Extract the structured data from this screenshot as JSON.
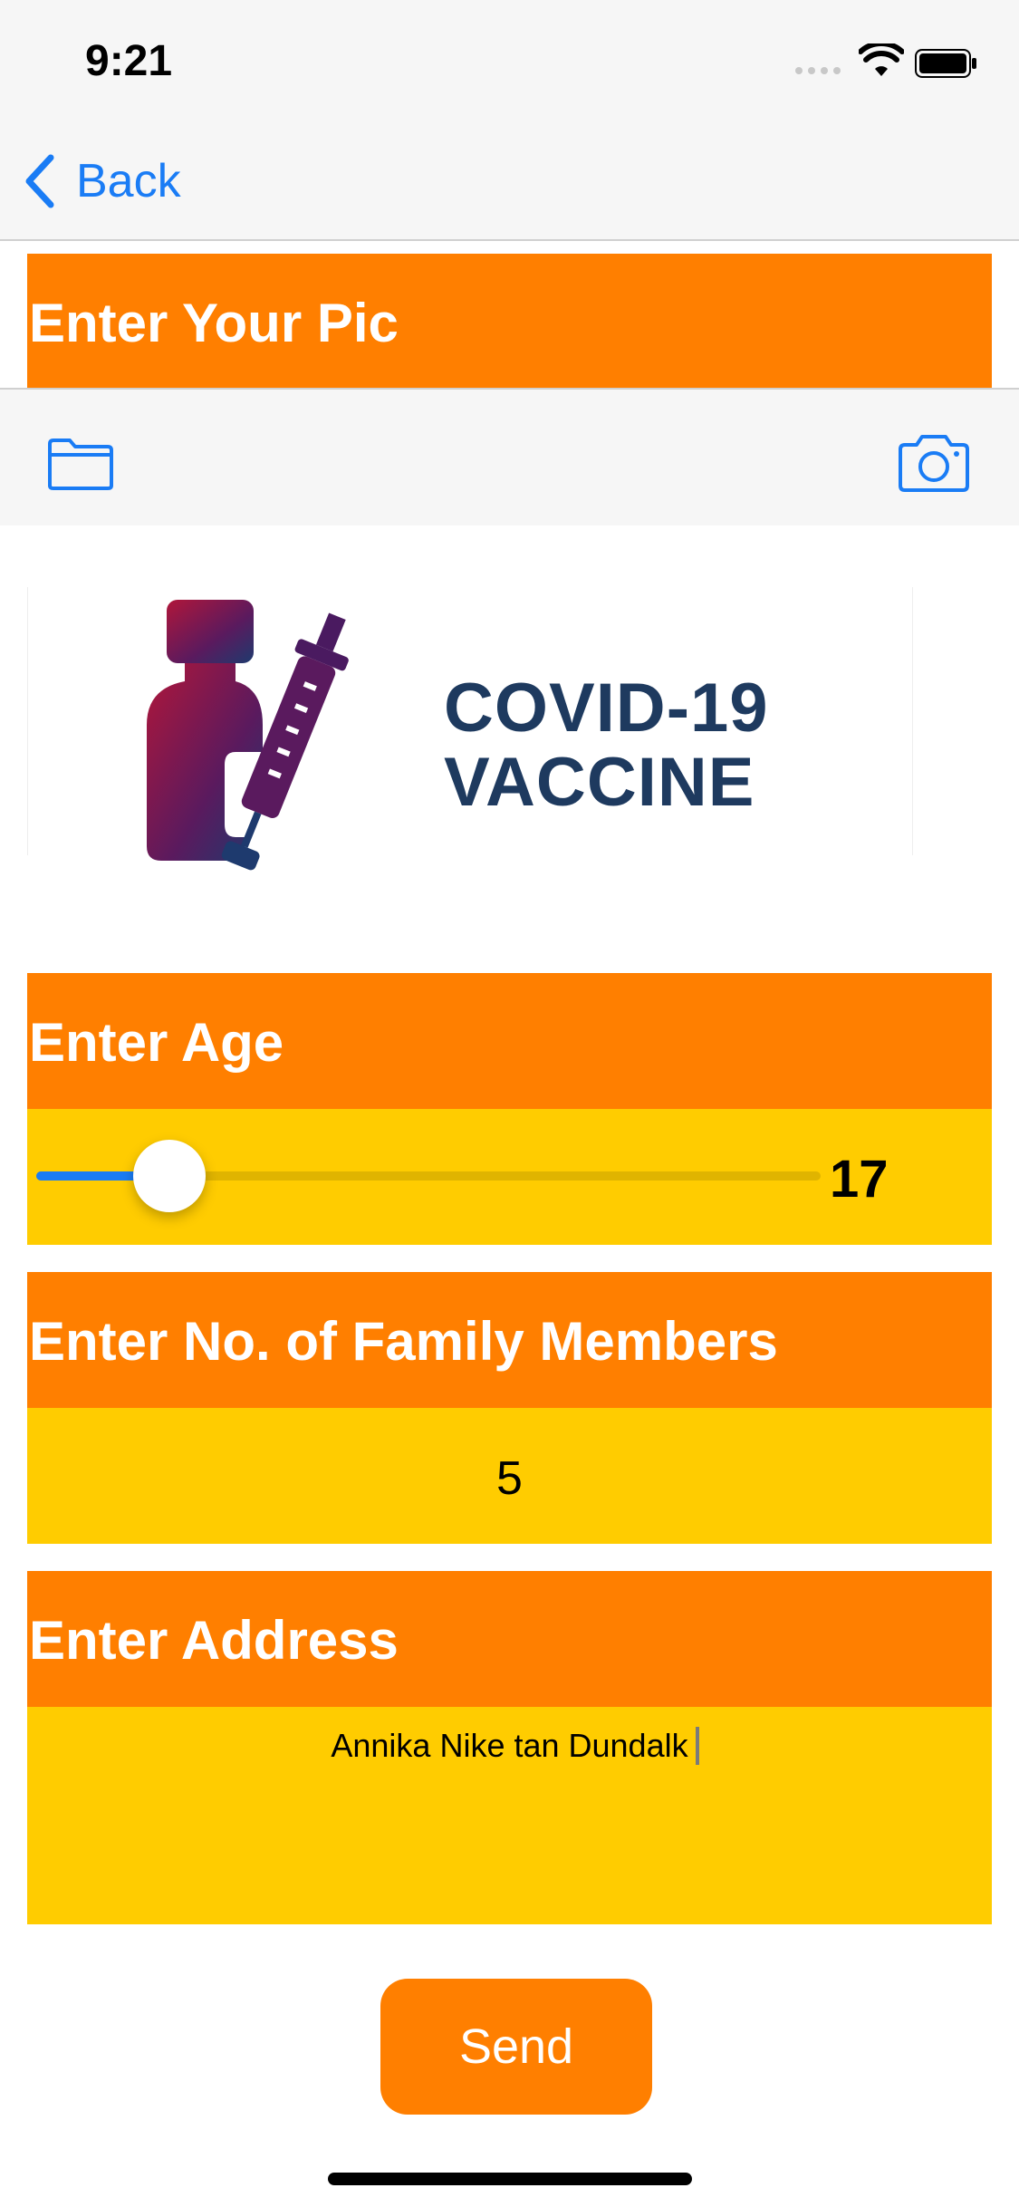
{
  "status_bar": {
    "time": "9:21"
  },
  "nav": {
    "back_label": "Back"
  },
  "pic_section": {
    "title": "Enter Your Pic"
  },
  "toolbar": {
    "folder_icon": "folder-icon",
    "camera_icon": "camera-icon"
  },
  "image": {
    "line1": "COVID-19",
    "line2": "VACCINE"
  },
  "age_section": {
    "title": "Enter Age",
    "value": "17",
    "slider_fraction": 0.17
  },
  "family_section": {
    "title": "Enter No. of Family Members",
    "value": "5"
  },
  "address_section": {
    "title": "Enter Address",
    "value": "Annika Nike tan Dundalk"
  },
  "send_button": {
    "label": "Send"
  },
  "colors": {
    "accent_orange": "#ff7f00",
    "field_yellow": "#ffcc00",
    "ios_blue": "#1a7cf5"
  }
}
